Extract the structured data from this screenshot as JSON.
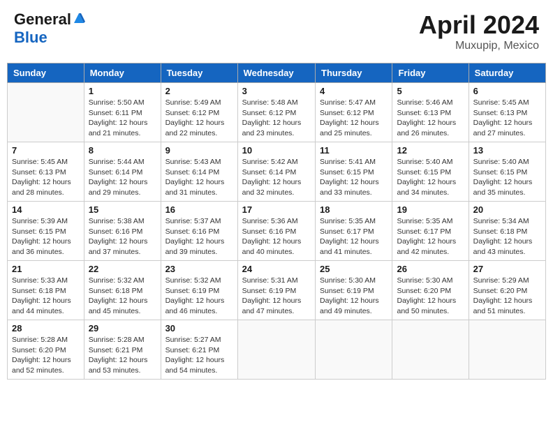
{
  "header": {
    "logo_general": "General",
    "logo_blue": "Blue",
    "title": "April 2024",
    "subtitle": "Muxupip, Mexico"
  },
  "weekdays": [
    "Sunday",
    "Monday",
    "Tuesday",
    "Wednesday",
    "Thursday",
    "Friday",
    "Saturday"
  ],
  "weeks": [
    [
      {
        "day": "",
        "sunrise": "",
        "sunset": "",
        "daylight": ""
      },
      {
        "day": "1",
        "sunrise": "Sunrise: 5:50 AM",
        "sunset": "Sunset: 6:11 PM",
        "daylight": "Daylight: 12 hours and 21 minutes."
      },
      {
        "day": "2",
        "sunrise": "Sunrise: 5:49 AM",
        "sunset": "Sunset: 6:12 PM",
        "daylight": "Daylight: 12 hours and 22 minutes."
      },
      {
        "day": "3",
        "sunrise": "Sunrise: 5:48 AM",
        "sunset": "Sunset: 6:12 PM",
        "daylight": "Daylight: 12 hours and 23 minutes."
      },
      {
        "day": "4",
        "sunrise": "Sunrise: 5:47 AM",
        "sunset": "Sunset: 6:12 PM",
        "daylight": "Daylight: 12 hours and 25 minutes."
      },
      {
        "day": "5",
        "sunrise": "Sunrise: 5:46 AM",
        "sunset": "Sunset: 6:13 PM",
        "daylight": "Daylight: 12 hours and 26 minutes."
      },
      {
        "day": "6",
        "sunrise": "Sunrise: 5:45 AM",
        "sunset": "Sunset: 6:13 PM",
        "daylight": "Daylight: 12 hours and 27 minutes."
      }
    ],
    [
      {
        "day": "7",
        "sunrise": "Sunrise: 5:45 AM",
        "sunset": "Sunset: 6:13 PM",
        "daylight": "Daylight: 12 hours and 28 minutes."
      },
      {
        "day": "8",
        "sunrise": "Sunrise: 5:44 AM",
        "sunset": "Sunset: 6:14 PM",
        "daylight": "Daylight: 12 hours and 29 minutes."
      },
      {
        "day": "9",
        "sunrise": "Sunrise: 5:43 AM",
        "sunset": "Sunset: 6:14 PM",
        "daylight": "Daylight: 12 hours and 31 minutes."
      },
      {
        "day": "10",
        "sunrise": "Sunrise: 5:42 AM",
        "sunset": "Sunset: 6:14 PM",
        "daylight": "Daylight: 12 hours and 32 minutes."
      },
      {
        "day": "11",
        "sunrise": "Sunrise: 5:41 AM",
        "sunset": "Sunset: 6:15 PM",
        "daylight": "Daylight: 12 hours and 33 minutes."
      },
      {
        "day": "12",
        "sunrise": "Sunrise: 5:40 AM",
        "sunset": "Sunset: 6:15 PM",
        "daylight": "Daylight: 12 hours and 34 minutes."
      },
      {
        "day": "13",
        "sunrise": "Sunrise: 5:40 AM",
        "sunset": "Sunset: 6:15 PM",
        "daylight": "Daylight: 12 hours and 35 minutes."
      }
    ],
    [
      {
        "day": "14",
        "sunrise": "Sunrise: 5:39 AM",
        "sunset": "Sunset: 6:15 PM",
        "daylight": "Daylight: 12 hours and 36 minutes."
      },
      {
        "day": "15",
        "sunrise": "Sunrise: 5:38 AM",
        "sunset": "Sunset: 6:16 PM",
        "daylight": "Daylight: 12 hours and 37 minutes."
      },
      {
        "day": "16",
        "sunrise": "Sunrise: 5:37 AM",
        "sunset": "Sunset: 6:16 PM",
        "daylight": "Daylight: 12 hours and 39 minutes."
      },
      {
        "day": "17",
        "sunrise": "Sunrise: 5:36 AM",
        "sunset": "Sunset: 6:16 PM",
        "daylight": "Daylight: 12 hours and 40 minutes."
      },
      {
        "day": "18",
        "sunrise": "Sunrise: 5:35 AM",
        "sunset": "Sunset: 6:17 PM",
        "daylight": "Daylight: 12 hours and 41 minutes."
      },
      {
        "day": "19",
        "sunrise": "Sunrise: 5:35 AM",
        "sunset": "Sunset: 6:17 PM",
        "daylight": "Daylight: 12 hours and 42 minutes."
      },
      {
        "day": "20",
        "sunrise": "Sunrise: 5:34 AM",
        "sunset": "Sunset: 6:18 PM",
        "daylight": "Daylight: 12 hours and 43 minutes."
      }
    ],
    [
      {
        "day": "21",
        "sunrise": "Sunrise: 5:33 AM",
        "sunset": "Sunset: 6:18 PM",
        "daylight": "Daylight: 12 hours and 44 minutes."
      },
      {
        "day": "22",
        "sunrise": "Sunrise: 5:32 AM",
        "sunset": "Sunset: 6:18 PM",
        "daylight": "Daylight: 12 hours and 45 minutes."
      },
      {
        "day": "23",
        "sunrise": "Sunrise: 5:32 AM",
        "sunset": "Sunset: 6:19 PM",
        "daylight": "Daylight: 12 hours and 46 minutes."
      },
      {
        "day": "24",
        "sunrise": "Sunrise: 5:31 AM",
        "sunset": "Sunset: 6:19 PM",
        "daylight": "Daylight: 12 hours and 47 minutes."
      },
      {
        "day": "25",
        "sunrise": "Sunrise: 5:30 AM",
        "sunset": "Sunset: 6:19 PM",
        "daylight": "Daylight: 12 hours and 49 minutes."
      },
      {
        "day": "26",
        "sunrise": "Sunrise: 5:30 AM",
        "sunset": "Sunset: 6:20 PM",
        "daylight": "Daylight: 12 hours and 50 minutes."
      },
      {
        "day": "27",
        "sunrise": "Sunrise: 5:29 AM",
        "sunset": "Sunset: 6:20 PM",
        "daylight": "Daylight: 12 hours and 51 minutes."
      }
    ],
    [
      {
        "day": "28",
        "sunrise": "Sunrise: 5:28 AM",
        "sunset": "Sunset: 6:20 PM",
        "daylight": "Daylight: 12 hours and 52 minutes."
      },
      {
        "day": "29",
        "sunrise": "Sunrise: 5:28 AM",
        "sunset": "Sunset: 6:21 PM",
        "daylight": "Daylight: 12 hours and 53 minutes."
      },
      {
        "day": "30",
        "sunrise": "Sunrise: 5:27 AM",
        "sunset": "Sunset: 6:21 PM",
        "daylight": "Daylight: 12 hours and 54 minutes."
      },
      {
        "day": "",
        "sunrise": "",
        "sunset": "",
        "daylight": ""
      },
      {
        "day": "",
        "sunrise": "",
        "sunset": "",
        "daylight": ""
      },
      {
        "day": "",
        "sunrise": "",
        "sunset": "",
        "daylight": ""
      },
      {
        "day": "",
        "sunrise": "",
        "sunset": "",
        "daylight": ""
      }
    ]
  ]
}
